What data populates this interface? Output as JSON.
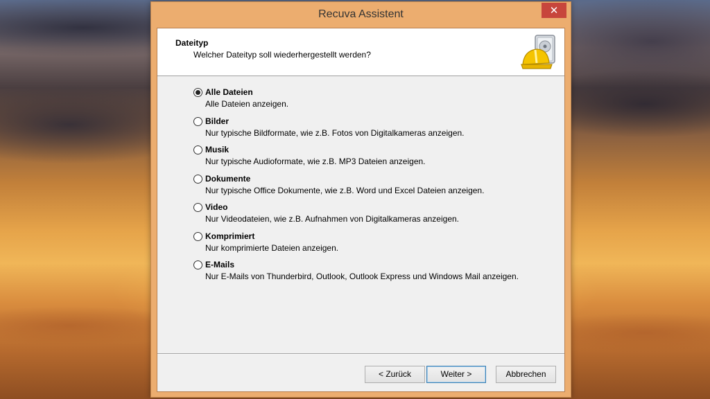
{
  "window": {
    "title": "Recuva Assistent",
    "close_glyph": "✕"
  },
  "header": {
    "title": "Dateityp",
    "subtitle": "Welcher Dateityp soll wiederhergestellt werden?",
    "logo_icon": "hard-drive-hardhat-icon"
  },
  "options": [
    {
      "label": "Alle Dateien",
      "description": "Alle Dateien anzeigen.",
      "selected": true
    },
    {
      "label": "Bilder",
      "description": "Nur typische Bildformate, wie z.B. Fotos von Digitalkameras anzeigen.",
      "selected": false
    },
    {
      "label": "Musik",
      "description": "Nur typische Audioformate, wie z.B. MP3 Dateien anzeigen.",
      "selected": false
    },
    {
      "label": "Dokumente",
      "description": "Nur typische Office Dokumente, wie z.B. Word und Excel Dateien anzeigen.",
      "selected": false
    },
    {
      "label": "Video",
      "description": "Nur Videodateien, wie z.B. Aufnahmen von Digitalkameras anzeigen.",
      "selected": false
    },
    {
      "label": "Komprimiert",
      "description": "Nur komprimierte Dateien anzeigen.",
      "selected": false
    },
    {
      "label": "E-Mails",
      "description": "Nur E-Mails von Thunderbird, Outlook, Outlook Express und Windows Mail anzeigen.",
      "selected": false
    }
  ],
  "buttons": {
    "back": "< Zurück",
    "next": "Weiter >",
    "cancel": "Abbrechen"
  },
  "colors": {
    "window_frame": "#ecad6f",
    "close_button": "#c7463c",
    "default_button_border": "#3c7fb1"
  }
}
